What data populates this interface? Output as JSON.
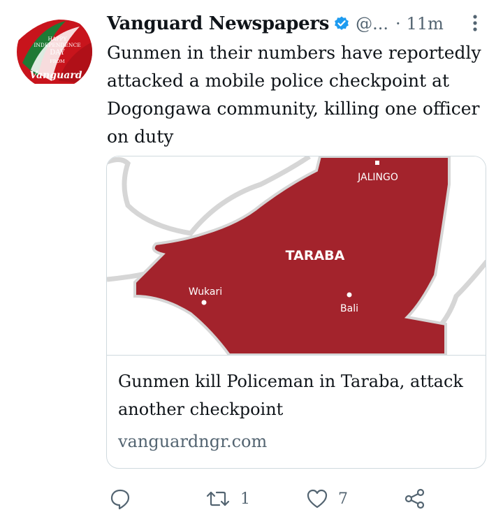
{
  "tweet": {
    "display_name": "Vanguard Newspapers",
    "handle": "@...",
    "separator": "·",
    "time": "11m",
    "text": "Gunmen in their numbers have reportedly attacked a mobile police checkpoint at Dogongawa community, killing one officer on duty",
    "avatar": {
      "line1": "HAPPY",
      "line2": "INDEPENDENCE",
      "line3": "DAY",
      "line4": "FROM",
      "brand": "Vanguard"
    }
  },
  "card": {
    "map_labels": {
      "state": "TARABA",
      "city1": "JALINGO",
      "city2": "Wukari",
      "city3": "Bali"
    },
    "title": "Gunmen kill Policeman in Taraba, attack another checkpoint",
    "domain": "vanguardngr.com"
  },
  "actions": {
    "reply": {
      "icon": "reply-icon"
    },
    "retweet": {
      "icon": "retweet-icon",
      "count": "1"
    },
    "like": {
      "icon": "heart-icon",
      "count": "7"
    },
    "share": {
      "icon": "share-icon"
    }
  },
  "colors": {
    "text": "#0f1419",
    "muted": "#536471",
    "verified": "#1d9bf0",
    "map_fill": "#a3232c",
    "border": "#cfd9de"
  }
}
